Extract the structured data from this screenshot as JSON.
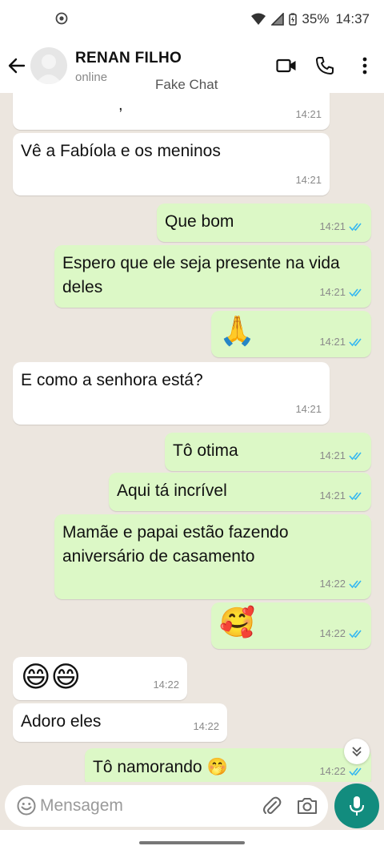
{
  "status_bar": {
    "battery": "35%",
    "time": "14:37"
  },
  "header": {
    "contact_name": "RENAN FILHO",
    "contact_status": "online",
    "overlay_label": "Fake Chat"
  },
  "messages": [
    {
      "dir": "in",
      "text": "",
      "time": "14:21"
    },
    {
      "dir": "in",
      "text": "Vê a Fabíola e os meninos",
      "time": "14:21"
    },
    {
      "dir": "out",
      "text": "Que bom",
      "time": "14:21"
    },
    {
      "dir": "out",
      "text": "Espero que ele seja presente na vida deles",
      "time": "14:21"
    },
    {
      "dir": "out",
      "text": "🙏",
      "time": "14:21"
    },
    {
      "dir": "in",
      "text": "E como a senhora está?",
      "time": "14:21"
    },
    {
      "dir": "out",
      "text": "Tô otima",
      "time": "14:21"
    },
    {
      "dir": "out",
      "text": "Aqui tá incrível",
      "time": "14:21"
    },
    {
      "dir": "out",
      "text": "Mamãe e papai estão fazendo aniversário de casamento",
      "time": "14:22"
    },
    {
      "dir": "out",
      "text": "🥰",
      "time": "14:22"
    },
    {
      "dir": "in",
      "text": "😄😄",
      "time": "14:22"
    },
    {
      "dir": "in",
      "text": "Adoro eles",
      "time": "14:22"
    },
    {
      "dir": "out",
      "text": "Tô namorando",
      "emoji": "🤭",
      "time": "14:22"
    }
  ],
  "input": {
    "placeholder": "Mensagem",
    "value": ""
  },
  "colors": {
    "chat_bg": "#ece6df",
    "incoming_bubble": "#ffffff",
    "outgoing_bubble": "#dcf8c6",
    "read_ticks": "#34b7f1",
    "mic_button": "#128c7e"
  },
  "icons": [
    "back-arrow-icon",
    "video-call-icon",
    "phone-icon",
    "more-vert-icon",
    "emoji-icon",
    "attach-icon",
    "camera-icon",
    "mic-icon",
    "double-check-icon",
    "chevron-double-down-icon"
  ]
}
